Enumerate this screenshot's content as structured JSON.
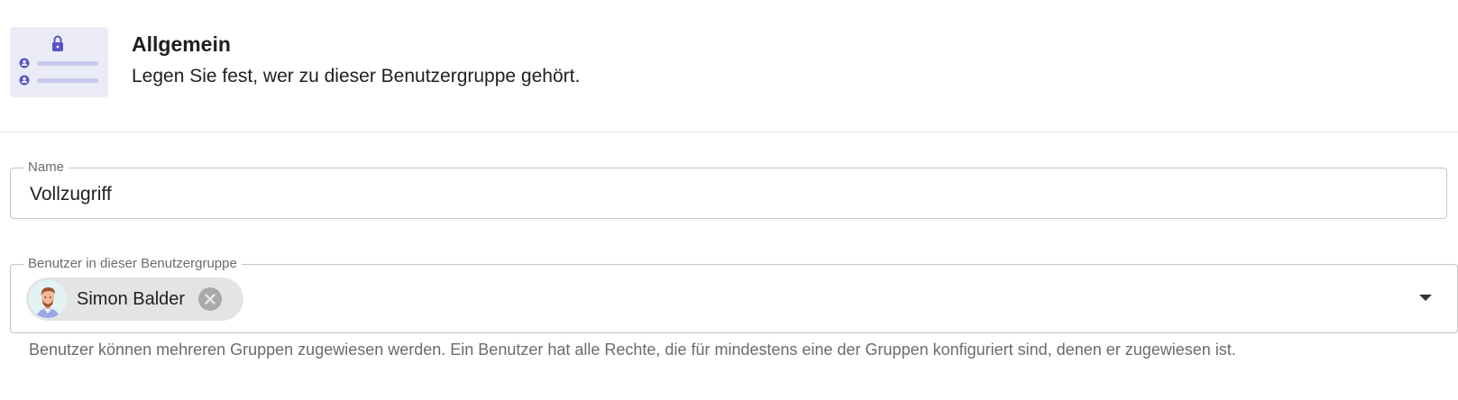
{
  "section": {
    "title": "Allgemein",
    "subtitle": "Legen Sie fest, wer zu dieser Benutzergruppe gehört.",
    "illustration_icon": "lock-user-list-illustration"
  },
  "name_field": {
    "label": "Name",
    "value": "Vollzugriff"
  },
  "users_field": {
    "label": "Benutzer in dieser Benutzergruppe",
    "chips": [
      {
        "label": "Simon Balder",
        "avatar": "male-avatar-icon",
        "delete_icon": "cancel-circle-icon"
      }
    ],
    "dropdown_icon": "arrow-drop-down-icon",
    "helper_text": "Benutzer können mehreren Gruppen zugewiesen werden. Ein Benutzer hat alle Rechte, die für mindestens eine der Gruppen konfiguriert sind, denen er zugewiesen ist."
  },
  "colors": {
    "accent": "#5b55c4",
    "illustration_bg": "#ebebf8",
    "chip_bg": "#e4e4e4",
    "border": "#c4c4c4"
  }
}
